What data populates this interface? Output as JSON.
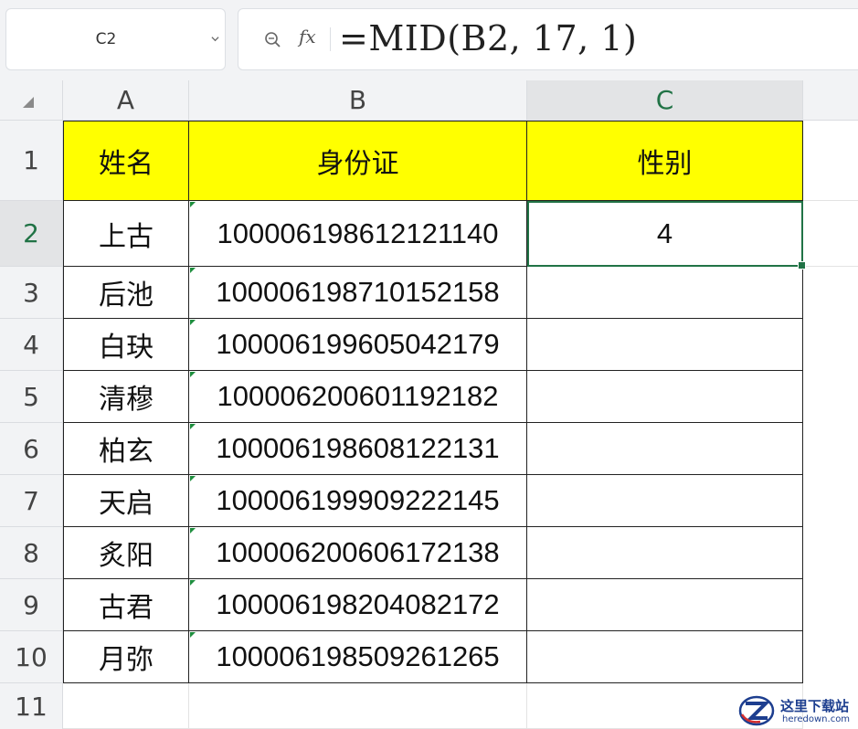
{
  "name_box": {
    "value": "C2"
  },
  "formula_bar": {
    "fx_label": "fx",
    "formula": "=MID(B2, 17, 1)"
  },
  "columns": [
    "A",
    "B",
    "C"
  ],
  "rows": [
    "1",
    "2",
    "3",
    "4",
    "5",
    "6",
    "7",
    "8",
    "9",
    "10",
    "11"
  ],
  "active_cell": "C2",
  "header_row": {
    "a": "姓名",
    "b": "身份证",
    "c": "性别"
  },
  "data_rows": [
    {
      "name": "上古",
      "id": "100006198612121140",
      "gender": "4"
    },
    {
      "name": "后池",
      "id": "100006198710152158",
      "gender": ""
    },
    {
      "name": "白玦",
      "id": "100006199605042179",
      "gender": ""
    },
    {
      "name": "清穆",
      "id": "100006200601192182",
      "gender": ""
    },
    {
      "name": "柏玄",
      "id": "100006198608122131",
      "gender": ""
    },
    {
      "name": "天启",
      "id": "100006199909222145",
      "gender": ""
    },
    {
      "name": "炙阳",
      "id": "100006200606172138",
      "gender": ""
    },
    {
      "name": "古君",
      "id": "100006198204082172",
      "gender": ""
    },
    {
      "name": "月弥",
      "id": "100006198509261265",
      "gender": ""
    }
  ],
  "watermark": {
    "line1": "这里下载站",
    "line2": "heredown.com"
  },
  "colors": {
    "header_fill": "#ffff00",
    "selection": "#217346",
    "watermark": "#1d3e8f"
  }
}
